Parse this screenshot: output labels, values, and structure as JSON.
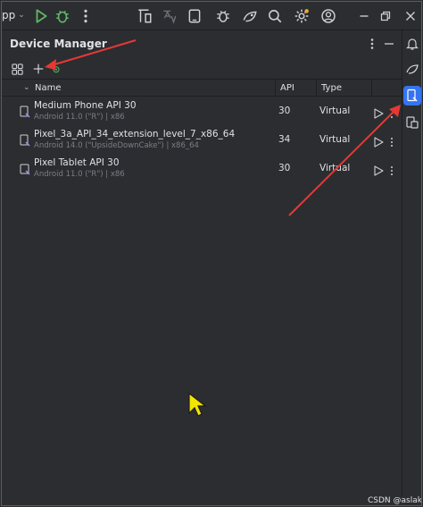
{
  "toolbar": {
    "app_label": "pp",
    "colors": {
      "run": "#5fb865",
      "debug": "#5fb865"
    }
  },
  "panel": {
    "title": "Device Manager"
  },
  "table": {
    "columns": [
      "Name",
      "API",
      "Type"
    ],
    "rows": [
      {
        "name": "Medium Phone API 30",
        "sub": "Android 11.0 (\"R\") | x86",
        "api": "30",
        "type": "Virtual"
      },
      {
        "name": "Pixel_3a_API_34_extension_level_7_x86_64",
        "sub": "Android 14.0 (\"UpsideDownCake\") | x86_64",
        "api": "34",
        "type": "Virtual"
      },
      {
        "name": "Pixel Tablet API 30",
        "sub": "Android 11.0 (\"R\") | x86",
        "api": "30",
        "type": "Virtual"
      }
    ]
  },
  "watermark": "CSDN @aslaka",
  "accent": "#3574f0",
  "annotation_color": "#e53935"
}
